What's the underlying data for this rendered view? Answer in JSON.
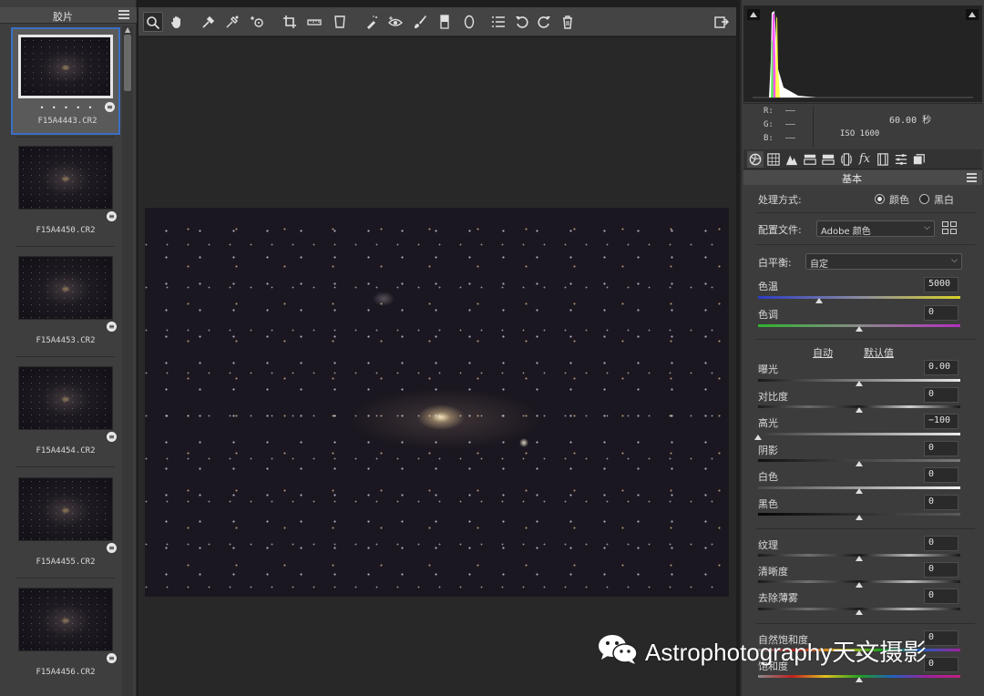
{
  "filmstrip": {
    "title": "胶片",
    "items": [
      {
        "name": "F15A4443.CR2",
        "selected": true,
        "rating_dots": "• • • • •"
      },
      {
        "name": "F15A4450.CR2"
      },
      {
        "name": "F15A4453.CR2"
      },
      {
        "name": "F15A4454.CR2"
      },
      {
        "name": "F15A4455.CR2"
      },
      {
        "name": "F15A4456.CR2"
      }
    ]
  },
  "toolbar": {
    "tools": [
      "zoom-tool",
      "hand-tool",
      "white-balance-tool",
      "color-sampler-tool",
      "targeted-adjustment-tool",
      "crop-tool",
      "straighten-tool",
      "transform-tool",
      "spot-removal-tool",
      "red-eye-tool",
      "adjustment-brush",
      "graduated-filter",
      "radial-filter",
      "preferences",
      "rotate-left",
      "rotate-right",
      "trash"
    ],
    "active_tool": "zoom-tool"
  },
  "info": {
    "r_label": "R:",
    "g_label": "G:",
    "b_label": "B:",
    "r_value": "——",
    "g_value": "——",
    "b_value": "——",
    "exposure": "60.00 秒",
    "iso": "ISO 1600"
  },
  "panel": {
    "title": "基本",
    "treatment_label": "处理方式:",
    "treatment_color": "颜色",
    "treatment_bw": "黑白",
    "profile_label": "配置文件:",
    "profile_value": "Adobe 颜色",
    "wb_label": "白平衡:",
    "wb_value": "自定",
    "temp_label": "色温",
    "temp_value": "5000",
    "tint_label": "色调",
    "tint_value": "0",
    "auto_label": "自动",
    "default_label": "默认值",
    "exposure_label": "曝光",
    "exposure_value": "0.00",
    "contrast_label": "对比度",
    "contrast_value": "0",
    "highlights_label": "高光",
    "highlights_value": "−100",
    "shadows_label": "阴影",
    "shadows_value": "0",
    "whites_label": "白色",
    "whites_value": "0",
    "blacks_label": "黑色",
    "blacks_value": "0",
    "texture_label": "纹理",
    "texture_value": "0",
    "clarity_label": "清晰度",
    "clarity_value": "0",
    "dehaze_label": "去除薄雾",
    "dehaze_value": "0",
    "vibrance_label": "自然饱和度",
    "vibrance_value": "0",
    "saturation_label": "饱和度",
    "saturation_value": "0"
  },
  "slider_levels": {
    "temp": 0.3,
    "tint": 0.5,
    "exposure": 0.5,
    "contrast": 0.5,
    "highlights": 0.0,
    "shadows": 0.5,
    "whites": 0.5,
    "blacks": 0.5,
    "texture": 0.5,
    "clarity": 0.5,
    "dehaze": 0.5,
    "vibrance": 0.5,
    "saturation": 0.5
  },
  "watermark": {
    "text": "Astrophotography天文摄影"
  }
}
